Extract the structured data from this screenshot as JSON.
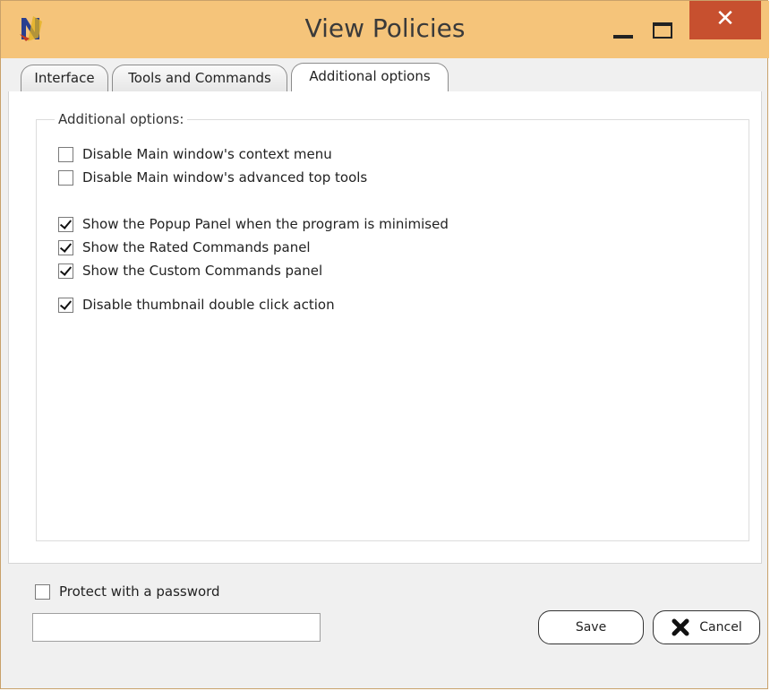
{
  "window": {
    "title": "View Policies",
    "title_bar_color": "#f5c47a",
    "close_color": "#c7502f",
    "controls": {
      "minimize": "minimize-icon",
      "maximize": "maximize-icon",
      "close_glyph": "✕"
    }
  },
  "tabs": [
    {
      "label": "Interface",
      "active": false
    },
    {
      "label": "Tools and Commands",
      "active": false
    },
    {
      "label": "Additional options",
      "active": true
    }
  ],
  "options": {
    "legend": "Additional options:",
    "items": [
      {
        "label": "Disable Main window's context menu",
        "checked": false
      },
      {
        "label": "Disable Main window's advanced top tools",
        "checked": false
      },
      {
        "label": "Show the Popup Panel when the program is minimised",
        "checked": true
      },
      {
        "label": "Show the Rated Commands panel",
        "checked": true
      },
      {
        "label": "Show the Custom Commands panel",
        "checked": true
      },
      {
        "label": "Disable thumbnail double click action",
        "checked": true
      }
    ]
  },
  "password": {
    "label": "Protect with a password",
    "checked": false,
    "value": ""
  },
  "buttons": {
    "save": "Save",
    "cancel": "Cancel"
  }
}
